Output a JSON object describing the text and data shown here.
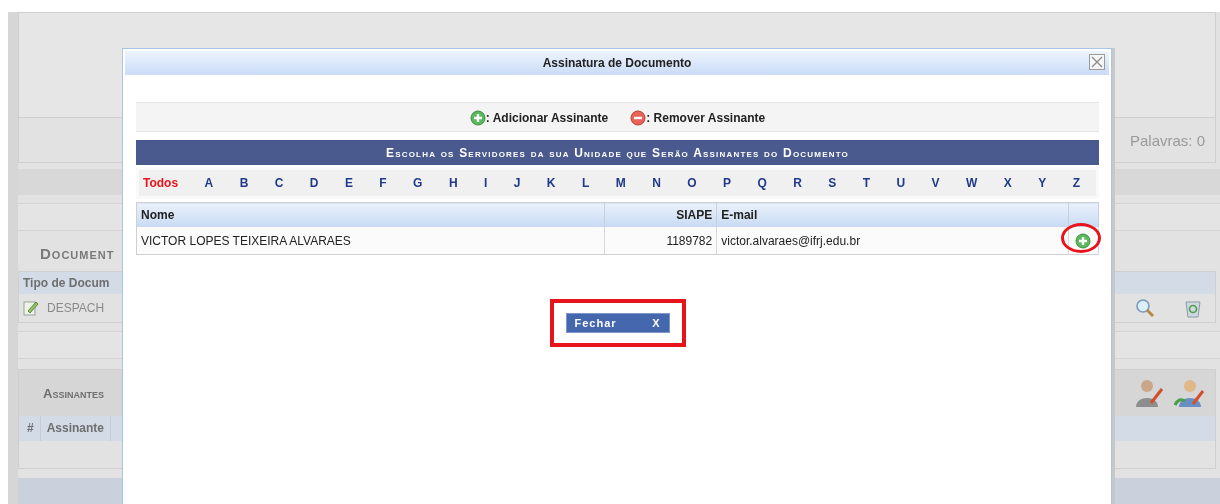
{
  "background": {
    "word_count": "Palavras: 0",
    "section_title": "Document",
    "document_column": "Tipo de Docum",
    "document_row": "DESPACH",
    "signers_title": "Assinantes",
    "signers_columns": [
      "#",
      "Assinante"
    ]
  },
  "dialog": {
    "title": "Assinatura de Documento",
    "legend": [
      {
        "kind": "add",
        "label": ": Adicionar Assinante"
      },
      {
        "kind": "remove",
        "label": ": Remover Assinante"
      }
    ],
    "heading": "Escolha os Servidores da sua Unidade que Serão Assinantes do Documento",
    "letters": [
      {
        "label": "Todos",
        "selected": true
      },
      {
        "label": "A",
        "selected": false
      },
      {
        "label": "B",
        "selected": false
      },
      {
        "label": "C",
        "selected": false
      },
      {
        "label": "D",
        "selected": false
      },
      {
        "label": "E",
        "selected": false
      },
      {
        "label": "F",
        "selected": false
      },
      {
        "label": "G",
        "selected": false
      },
      {
        "label": "H",
        "selected": false
      },
      {
        "label": "I",
        "selected": false
      },
      {
        "label": "J",
        "selected": false
      },
      {
        "label": "K",
        "selected": false
      },
      {
        "label": "L",
        "selected": false
      },
      {
        "label": "M",
        "selected": false
      },
      {
        "label": "N",
        "selected": false
      },
      {
        "label": "O",
        "selected": false
      },
      {
        "label": "P",
        "selected": false
      },
      {
        "label": "Q",
        "selected": false
      },
      {
        "label": "R",
        "selected": false
      },
      {
        "label": "S",
        "selected": false
      },
      {
        "label": "T",
        "selected": false
      },
      {
        "label": "U",
        "selected": false
      },
      {
        "label": "V",
        "selected": false
      },
      {
        "label": "W",
        "selected": false
      },
      {
        "label": "X",
        "selected": false
      },
      {
        "label": "Y",
        "selected": false
      },
      {
        "label": "Z",
        "selected": false
      }
    ],
    "columns": [
      "Nome",
      "SIAPE",
      "E-mail"
    ],
    "rows": [
      {
        "name": "VICTOR LOPES TEIXEIRA ALVARAES",
        "siape": "1189782",
        "email": "victor.alvaraes@ifrj.edu.br",
        "highlighted": true
      }
    ],
    "close_button": {
      "label": "Fechar",
      "icon": "X",
      "highlighted": true
    }
  }
}
